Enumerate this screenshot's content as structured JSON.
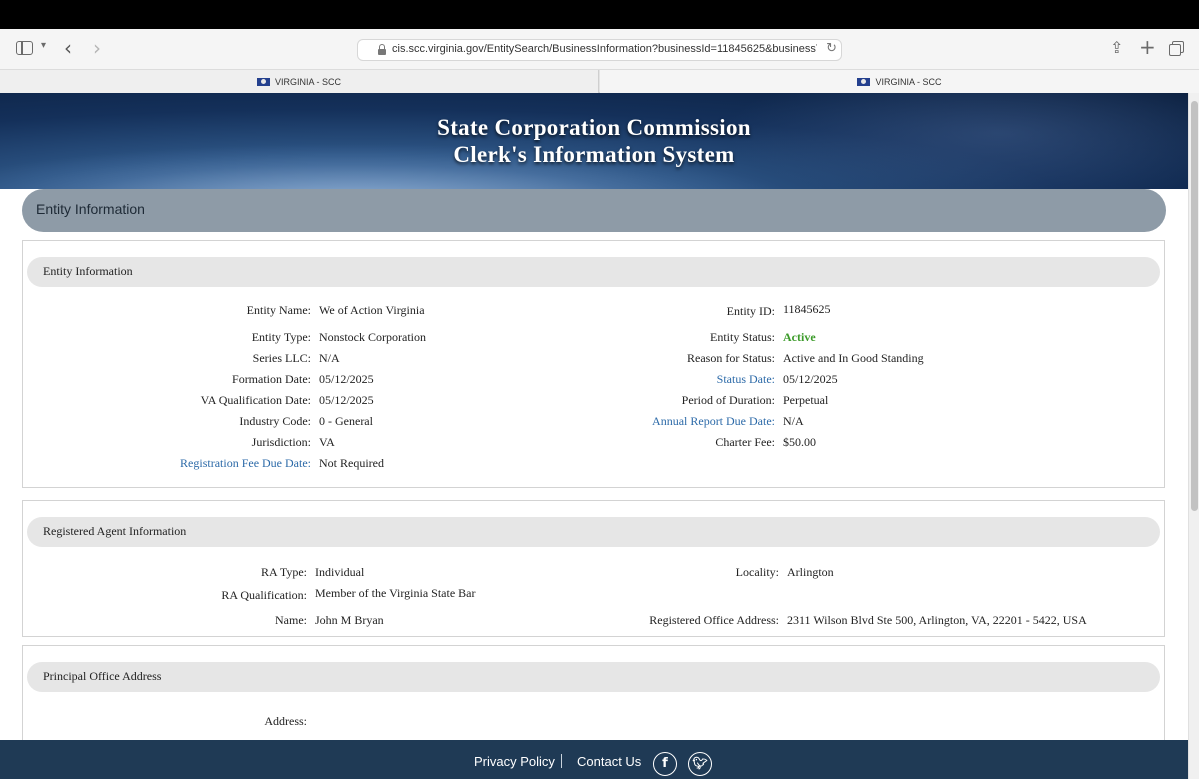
{
  "browser": {
    "url": "cis.scc.virginia.gov/EntitySearch/BusinessInformation?businessId=11845625&businessTy",
    "tabs": [
      {
        "label": "VIRGINIA - SCC"
      },
      {
        "label": "VIRGINIA - SCC"
      }
    ]
  },
  "banner": {
    "line1": "State Corporation Commission",
    "line2": "Clerk's Information System"
  },
  "page_header": "Entity Information",
  "entity": {
    "section_title": "Entity Information",
    "left": [
      {
        "label": "Entity Name:",
        "value": "We of Action Virginia",
        "link": false
      },
      {
        "label": "Entity Type:",
        "value": "Nonstock Corporation",
        "link": false
      },
      {
        "label": "Series LLC:",
        "value": "N/A",
        "link": false
      },
      {
        "label": "Formation Date:",
        "value": "05/12/2025",
        "link": false
      },
      {
        "label": "VA Qualification Date:",
        "value": "05/12/2025",
        "link": false
      },
      {
        "label": "Industry Code:",
        "value": "0 - General",
        "link": false
      },
      {
        "label": "Jurisdiction:",
        "value": "VA",
        "link": false
      },
      {
        "label": "Registration Fee Due Date:",
        "value": "Not Required",
        "link": true
      }
    ],
    "right": [
      {
        "label": "Entity ID:",
        "value": "11845625",
        "link": false
      },
      {
        "label": "Entity Status:",
        "value": "Active",
        "link": false
      },
      {
        "label": "Reason for Status:",
        "value": "Active and In Good Standing",
        "link": false
      },
      {
        "label": "Status Date:",
        "value": "05/12/2025",
        "link": true
      },
      {
        "label": "Period of Duration:",
        "value": "Perpetual",
        "link": false
      },
      {
        "label": "Annual Report Due Date:",
        "value": "N/A",
        "link": true
      },
      {
        "label": "Charter Fee:",
        "value": "$50.00",
        "link": false
      }
    ]
  },
  "agent": {
    "section_title": "Registered Agent Information",
    "ra_type_label": "RA Type:",
    "ra_type": "Individual",
    "ra_qual_label": "RA Qualification:",
    "ra_qual": "Member of the Virginia State Bar",
    "name_label": "Name:",
    "name": "John M Bryan",
    "locality_label": "Locality:",
    "locality": "Arlington",
    "office_label": "Registered Office Address:",
    "office": "2311 Wilson Blvd Ste 500, Arlington, VA, 22201 - 5422, USA"
  },
  "principal": {
    "section_title": "Principal Office Address",
    "address_label": "Address:",
    "address": ""
  },
  "footer": {
    "privacy": "Privacy Policy",
    "contact": "Contact Us"
  },
  "colors": {
    "header_pill": "#8e9ba7",
    "footer": "#1f3a55",
    "link": "#2c6aa8",
    "active": "#3c9b2a"
  }
}
